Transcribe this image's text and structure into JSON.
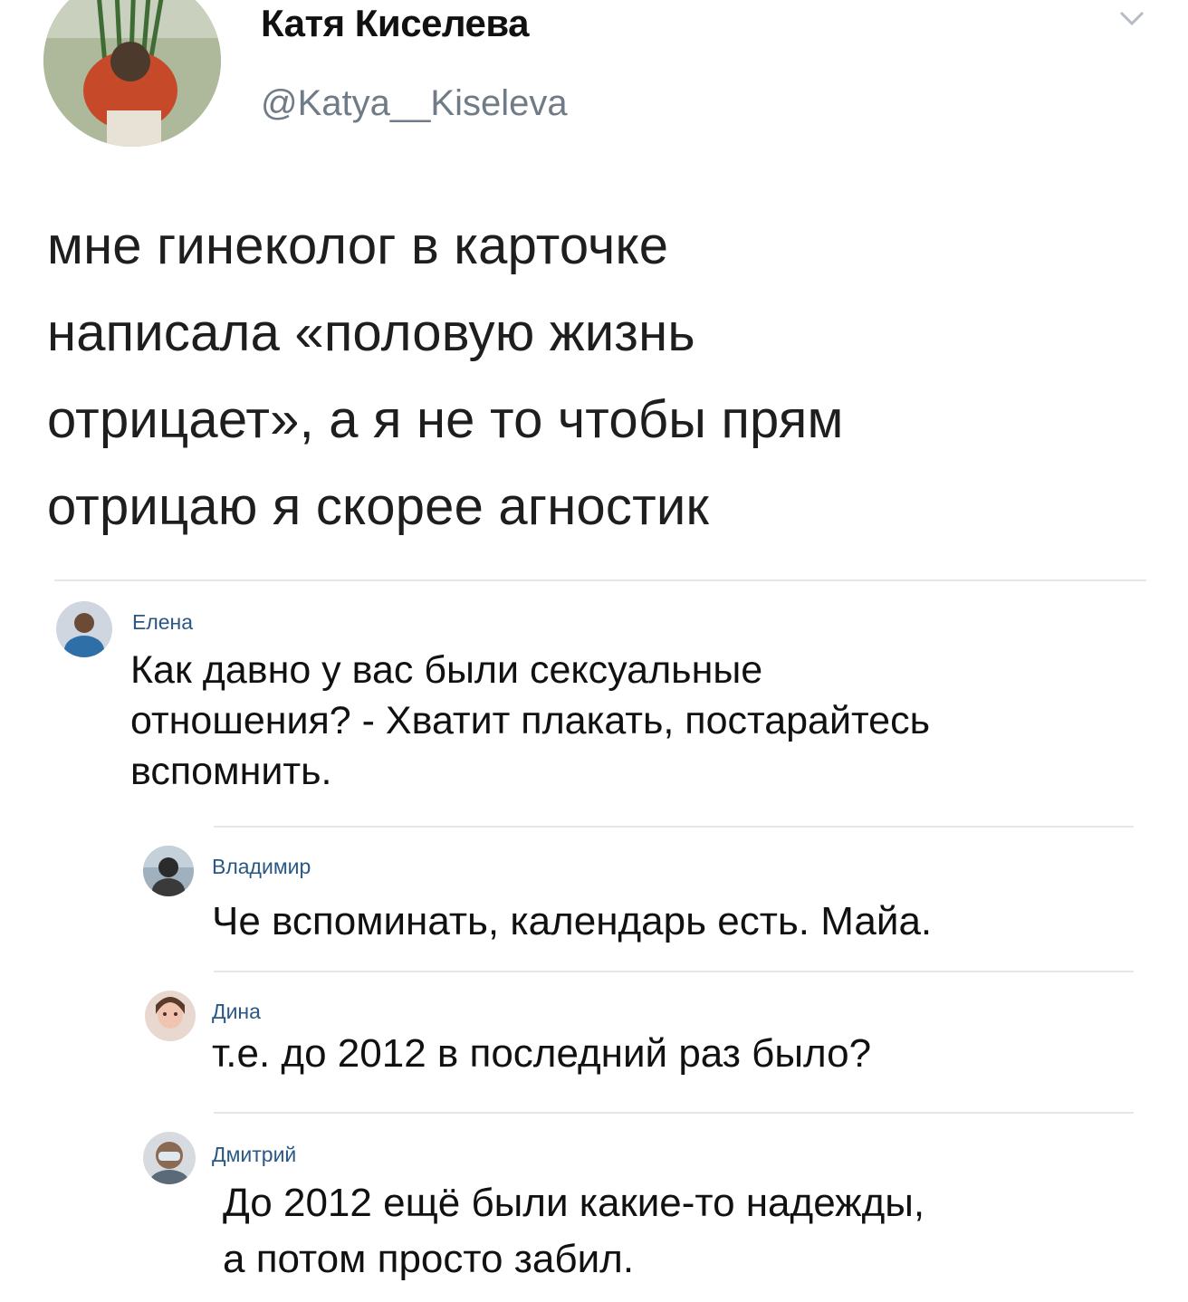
{
  "tweet": {
    "author_name": "Катя Киселева",
    "author_handle": "@Katya__Kiseleva",
    "text_lines": [
      "мне гинеколог в карточке",
      "написала «половую жизнь",
      "отрицает», а я не то чтобы прям",
      "отрицаю я скорее агностик"
    ],
    "menu_icon": "chevron-down-icon"
  },
  "comments": [
    {
      "author": "Елена",
      "text_lines": [
        "Как давно у вас были сексуальные",
        "отношения? - Хватит плакать, постарайтесь",
        "вспомнить."
      ],
      "avatar_icon": "user-avatar"
    },
    {
      "author": "Владимир",
      "text_lines": [
        "Че вспоминать, календарь есть. Майа."
      ],
      "avatar_icon": "user-avatar"
    },
    {
      "author": "Дина",
      "text_lines": [
        "т.е. до 2012 в последний раз было?"
      ],
      "avatar_icon": "user-avatar"
    },
    {
      "author": "Дмитрий",
      "text_lines": [
        "До 2012 ещё были какие-то надежды,",
        "а потом просто забил."
      ],
      "avatar_icon": "user-avatar"
    }
  ],
  "colors": {
    "handle": "#6f7b86",
    "comment_author": "#2a5885",
    "divider": "#e3e6ea"
  }
}
